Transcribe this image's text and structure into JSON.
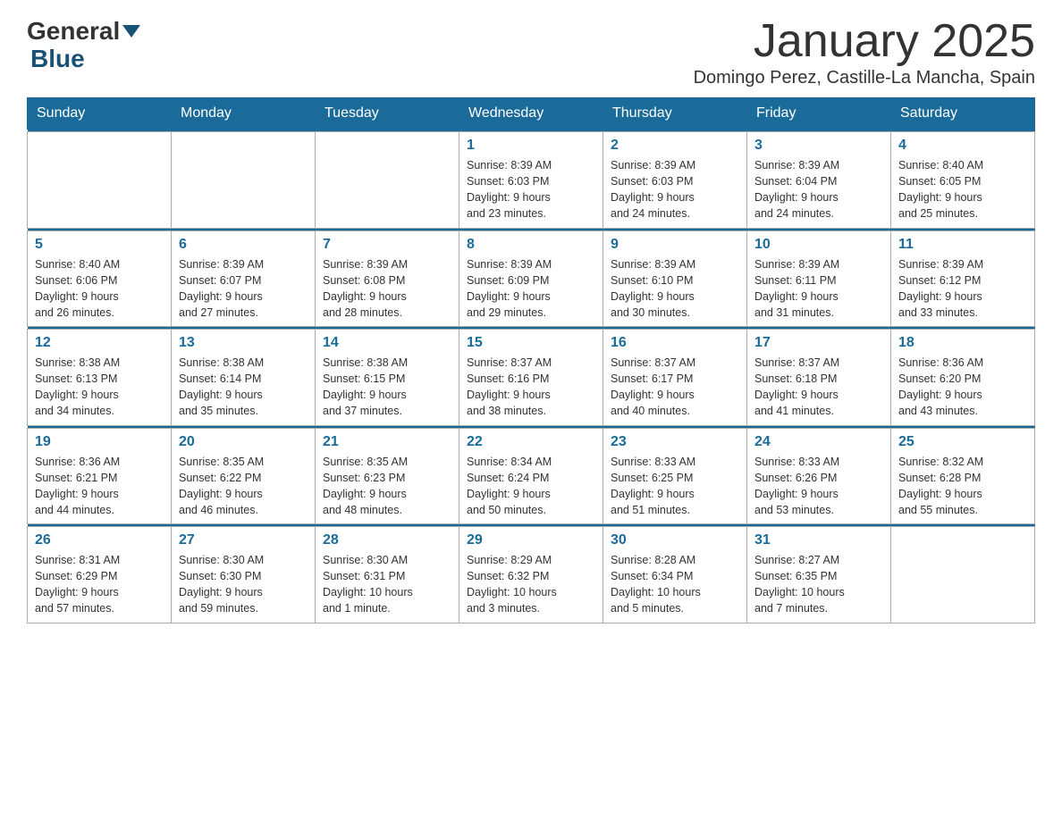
{
  "header": {
    "logo_general": "General",
    "logo_blue": "Blue",
    "month_title": "January 2025",
    "subtitle": "Domingo Perez, Castille-La Mancha, Spain"
  },
  "days_of_week": [
    "Sunday",
    "Monday",
    "Tuesday",
    "Wednesday",
    "Thursday",
    "Friday",
    "Saturday"
  ],
  "weeks": [
    [
      {
        "day": "",
        "info": ""
      },
      {
        "day": "",
        "info": ""
      },
      {
        "day": "",
        "info": ""
      },
      {
        "day": "1",
        "info": "Sunrise: 8:39 AM\nSunset: 6:03 PM\nDaylight: 9 hours\nand 23 minutes."
      },
      {
        "day": "2",
        "info": "Sunrise: 8:39 AM\nSunset: 6:03 PM\nDaylight: 9 hours\nand 24 minutes."
      },
      {
        "day": "3",
        "info": "Sunrise: 8:39 AM\nSunset: 6:04 PM\nDaylight: 9 hours\nand 24 minutes."
      },
      {
        "day": "4",
        "info": "Sunrise: 8:40 AM\nSunset: 6:05 PM\nDaylight: 9 hours\nand 25 minutes."
      }
    ],
    [
      {
        "day": "5",
        "info": "Sunrise: 8:40 AM\nSunset: 6:06 PM\nDaylight: 9 hours\nand 26 minutes."
      },
      {
        "day": "6",
        "info": "Sunrise: 8:39 AM\nSunset: 6:07 PM\nDaylight: 9 hours\nand 27 minutes."
      },
      {
        "day": "7",
        "info": "Sunrise: 8:39 AM\nSunset: 6:08 PM\nDaylight: 9 hours\nand 28 minutes."
      },
      {
        "day": "8",
        "info": "Sunrise: 8:39 AM\nSunset: 6:09 PM\nDaylight: 9 hours\nand 29 minutes."
      },
      {
        "day": "9",
        "info": "Sunrise: 8:39 AM\nSunset: 6:10 PM\nDaylight: 9 hours\nand 30 minutes."
      },
      {
        "day": "10",
        "info": "Sunrise: 8:39 AM\nSunset: 6:11 PM\nDaylight: 9 hours\nand 31 minutes."
      },
      {
        "day": "11",
        "info": "Sunrise: 8:39 AM\nSunset: 6:12 PM\nDaylight: 9 hours\nand 33 minutes."
      }
    ],
    [
      {
        "day": "12",
        "info": "Sunrise: 8:38 AM\nSunset: 6:13 PM\nDaylight: 9 hours\nand 34 minutes."
      },
      {
        "day": "13",
        "info": "Sunrise: 8:38 AM\nSunset: 6:14 PM\nDaylight: 9 hours\nand 35 minutes."
      },
      {
        "day": "14",
        "info": "Sunrise: 8:38 AM\nSunset: 6:15 PM\nDaylight: 9 hours\nand 37 minutes."
      },
      {
        "day": "15",
        "info": "Sunrise: 8:37 AM\nSunset: 6:16 PM\nDaylight: 9 hours\nand 38 minutes."
      },
      {
        "day": "16",
        "info": "Sunrise: 8:37 AM\nSunset: 6:17 PM\nDaylight: 9 hours\nand 40 minutes."
      },
      {
        "day": "17",
        "info": "Sunrise: 8:37 AM\nSunset: 6:18 PM\nDaylight: 9 hours\nand 41 minutes."
      },
      {
        "day": "18",
        "info": "Sunrise: 8:36 AM\nSunset: 6:20 PM\nDaylight: 9 hours\nand 43 minutes."
      }
    ],
    [
      {
        "day": "19",
        "info": "Sunrise: 8:36 AM\nSunset: 6:21 PM\nDaylight: 9 hours\nand 44 minutes."
      },
      {
        "day": "20",
        "info": "Sunrise: 8:35 AM\nSunset: 6:22 PM\nDaylight: 9 hours\nand 46 minutes."
      },
      {
        "day": "21",
        "info": "Sunrise: 8:35 AM\nSunset: 6:23 PM\nDaylight: 9 hours\nand 48 minutes."
      },
      {
        "day": "22",
        "info": "Sunrise: 8:34 AM\nSunset: 6:24 PM\nDaylight: 9 hours\nand 50 minutes."
      },
      {
        "day": "23",
        "info": "Sunrise: 8:33 AM\nSunset: 6:25 PM\nDaylight: 9 hours\nand 51 minutes."
      },
      {
        "day": "24",
        "info": "Sunrise: 8:33 AM\nSunset: 6:26 PM\nDaylight: 9 hours\nand 53 minutes."
      },
      {
        "day": "25",
        "info": "Sunrise: 8:32 AM\nSunset: 6:28 PM\nDaylight: 9 hours\nand 55 minutes."
      }
    ],
    [
      {
        "day": "26",
        "info": "Sunrise: 8:31 AM\nSunset: 6:29 PM\nDaylight: 9 hours\nand 57 minutes."
      },
      {
        "day": "27",
        "info": "Sunrise: 8:30 AM\nSunset: 6:30 PM\nDaylight: 9 hours\nand 59 minutes."
      },
      {
        "day": "28",
        "info": "Sunrise: 8:30 AM\nSunset: 6:31 PM\nDaylight: 10 hours\nand 1 minute."
      },
      {
        "day": "29",
        "info": "Sunrise: 8:29 AM\nSunset: 6:32 PM\nDaylight: 10 hours\nand 3 minutes."
      },
      {
        "day": "30",
        "info": "Sunrise: 8:28 AM\nSunset: 6:34 PM\nDaylight: 10 hours\nand 5 minutes."
      },
      {
        "day": "31",
        "info": "Sunrise: 8:27 AM\nSunset: 6:35 PM\nDaylight: 10 hours\nand 7 minutes."
      },
      {
        "day": "",
        "info": ""
      }
    ]
  ]
}
